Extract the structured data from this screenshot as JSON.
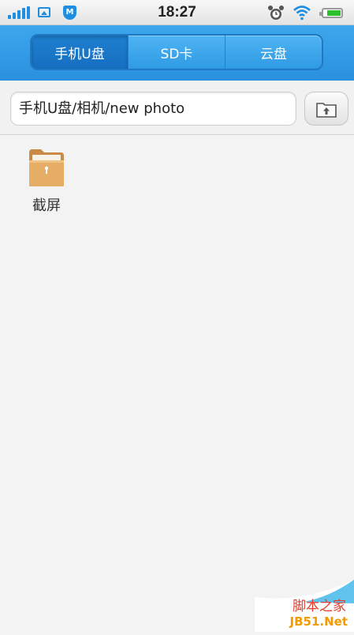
{
  "status_bar": {
    "time": "18:27",
    "icons": [
      "signal-icon",
      "image-icon",
      "shield-icon",
      "alarm-icon",
      "wifi-icon",
      "battery-icon"
    ],
    "shield_letter": "M"
  },
  "tabs": [
    {
      "label": "手机U盘",
      "active": true
    },
    {
      "label": "SD卡",
      "active": false
    },
    {
      "label": "云盘",
      "active": false
    }
  ],
  "path": "手机U盘/相机/new photo",
  "files": [
    {
      "name": "截屏",
      "icon": "folder-icon"
    }
  ],
  "watermark": {
    "line1": "脚本之家",
    "line2": "JB51.Net"
  },
  "colors": {
    "header": "#2a90df",
    "active_tab": "#166fc0",
    "battery": "#2ec12e",
    "folder": "#e0a662"
  }
}
